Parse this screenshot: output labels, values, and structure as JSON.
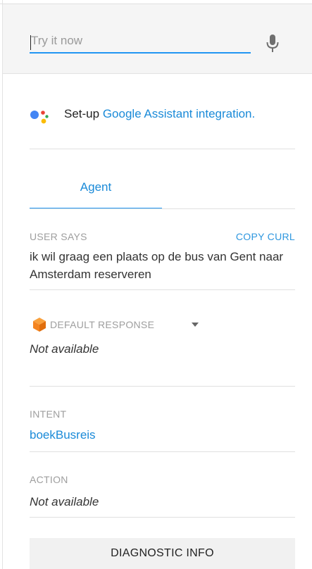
{
  "try_it": {
    "placeholder": "Try it now",
    "value": ""
  },
  "setup": {
    "prefix": "Set-up",
    "link": "Google Assistant integration."
  },
  "tabs": [
    {
      "label": "Agent",
      "active": true
    }
  ],
  "user_says": {
    "label": "USER SAYS",
    "copy_curl": "COPY CURL",
    "text": "ik wil graag een plaats op de bus van Gent naar Amsterdam reserveren"
  },
  "default_response": {
    "label": "DEFAULT RESPONSE",
    "value": "Not available"
  },
  "intent": {
    "label": "INTENT",
    "value": "boekBusreis"
  },
  "action": {
    "label": "ACTION",
    "value": "Not available"
  },
  "diagnostic": {
    "label": "DIAGNOSTIC INFO"
  },
  "icons": {
    "mic": "microphone-icon",
    "assistant": "google-assistant-logo",
    "response_source": "cube-icon",
    "dropdown": "caret-down-icon"
  },
  "colors": {
    "accent": "#2196f3",
    "link": "#1a8ad8",
    "muted_label": "#9e9e9e",
    "cube_orange": "#f4841f",
    "ga_blue": "#4285f4",
    "ga_red": "#ea4335",
    "ga_yellow": "#fbbc05",
    "ga_green": "#34a853"
  }
}
